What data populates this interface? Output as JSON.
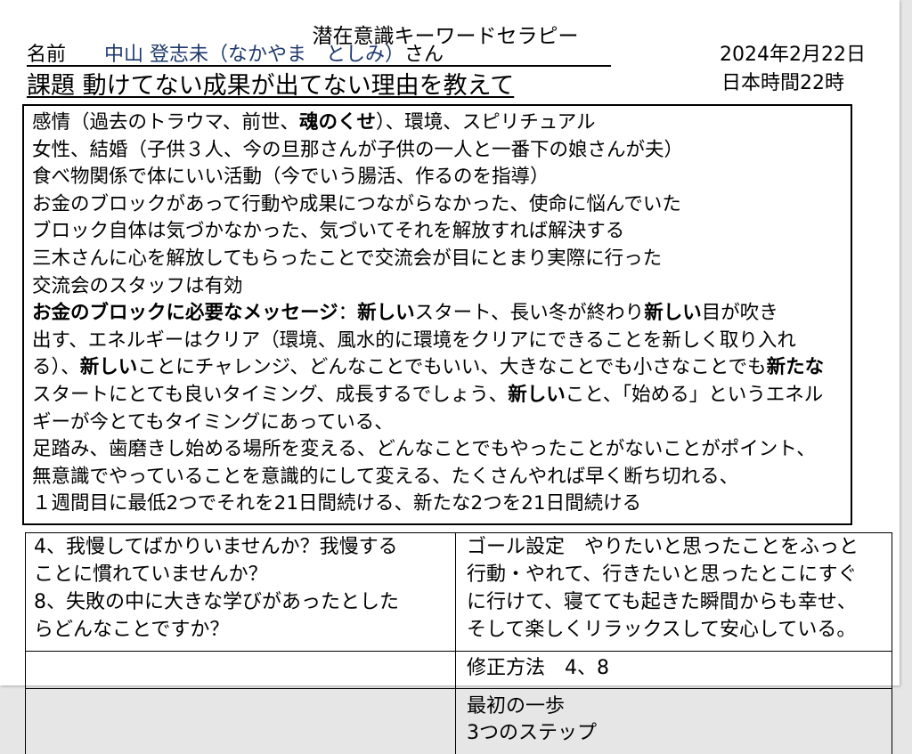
{
  "document": {
    "title": "潜在意識キーワードセラピー",
    "name_label": "名前",
    "client_name": "中山 登志未（なかやま　としみ）",
    "honorific": "さん",
    "date": "2024年2月22日",
    "time": "日本時間22時",
    "topic_label": "課題",
    "topic": "動けてない成果が出てない理由を教えて"
  },
  "notes": {
    "lines": [
      [
        "感情（過去のトラウマ、前世、",
        "魂のくせ",
        "）、環境、スピリチュアル"
      ],
      [
        "女性、結婚（子供３人、今の旦那さんが子供の一人と一番下の娘さんが夫）"
      ],
      [
        "食べ物関係で体にいい活動（今でいう腸活、作るのを指導）"
      ],
      [
        "お金のブロックがあって行動や成果につながらなかった、使命に悩んでいた"
      ],
      [
        "ブロック自体は気づかなかった、気づいてそれを解放すれば解決する"
      ],
      [
        "三木さんに心を解放してもらったことで交流会が目にとまり実際に行った"
      ],
      [
        "交流会のスタッフは有効"
      ],
      [
        "お金のブロックに必要なメッセージ",
        "：",
        "新しい",
        "スタート、長い冬が終わり",
        "新しい",
        "目が吹き"
      ],
      [
        "出す、エネルギーはクリア（環境、風水的に環境をクリアにできることを新しく取り入れ"
      ],
      [
        "る）、",
        "新しい",
        "ことにチャレンジ、どんなことでもいい、大きなことでも小さなことでも",
        "新たな"
      ],
      [
        "スタートにとても良いタイミング、成長するでしょう、",
        "新しい",
        "こと、「始める」というエネル"
      ],
      [
        "ギーが今とてもタイミングにあっている、"
      ],
      [
        "足踏み、歯磨きし始める場所を変える、どんなことでもやったことがないことがポイント、"
      ],
      [
        "無意識でやっていることを意識的にして変える、たくさんやれば早く断ち切れる、"
      ],
      [
        "１週間目に最低2つでそれを21日間続ける、新たな2つを21日間続ける"
      ]
    ]
  },
  "table": {
    "questions": [
      "4、我慢してばかりいませんか？我慢する",
      "ことに慣れていませんか？",
      "8、失敗の中に大きな学びがあったとした",
      "らどんなことですか？"
    ],
    "goal": [
      "ゴール設定　やりたいと思ったことをふっと",
      "行動・やれて、行きたいと思ったとこにすぐ",
      "に行けて、寝てても起きた瞬間からも幸せ、",
      "そして楽しくリラックスして安心している。"
    ],
    "correction_method": "修正方法　4、8",
    "first_step": [
      "最初の一歩",
      "3つのステップ"
    ]
  },
  "colors": {
    "client_name": "#1f3a6e",
    "page": "#ffffff",
    "viewer_background": "#e6e6e6",
    "text": "#000000"
  }
}
